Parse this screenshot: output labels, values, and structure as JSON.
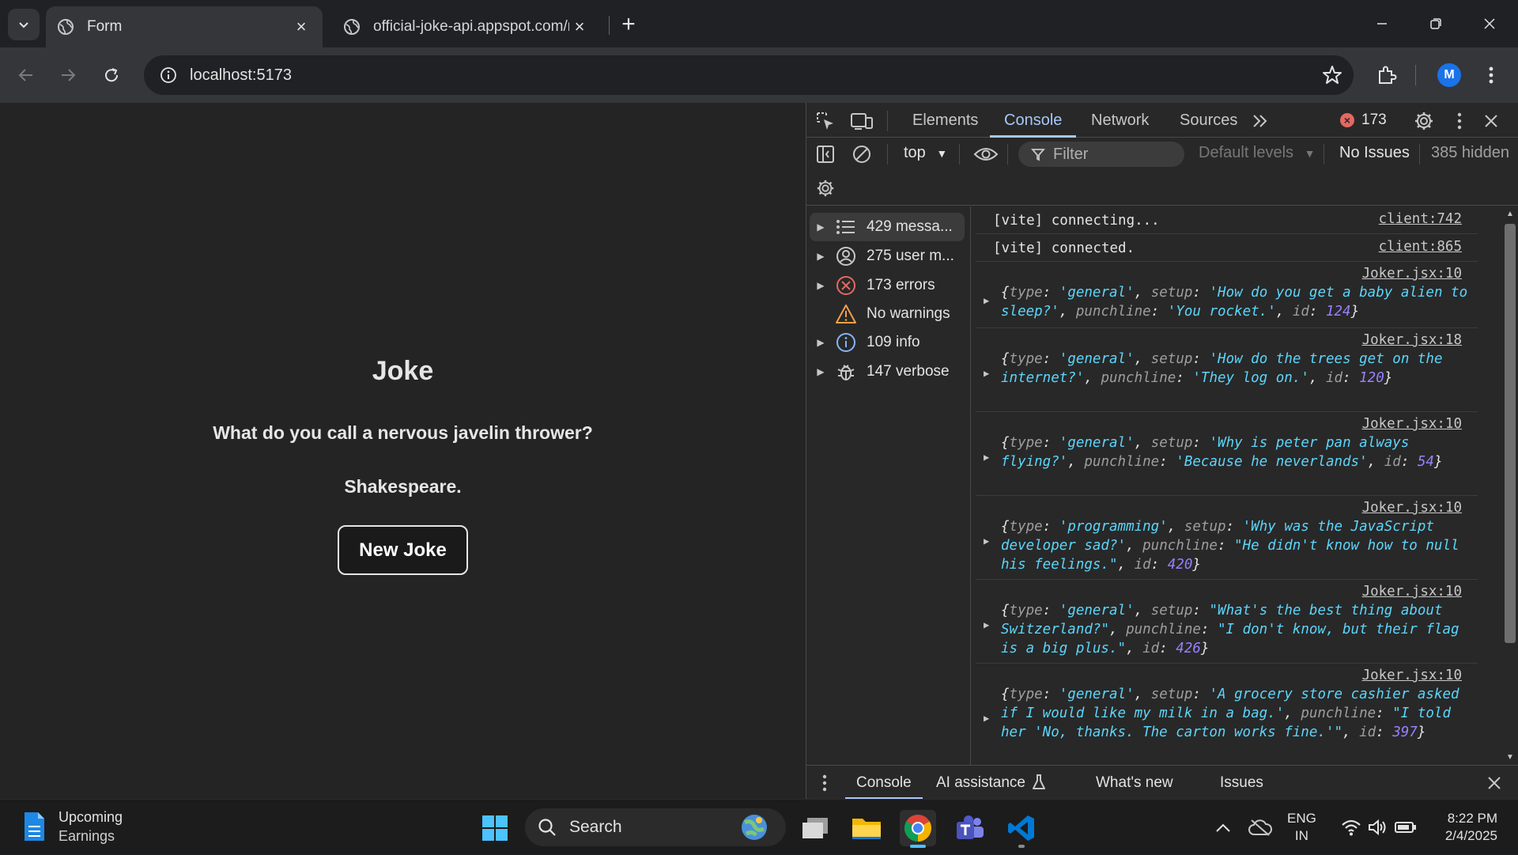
{
  "browser": {
    "tabs": [
      {
        "title": "Form",
        "active": true
      },
      {
        "title": "official-joke-api.appspot.com/r",
        "active": false
      }
    ],
    "url": "localhost:5173",
    "profile_initial": "M"
  },
  "page": {
    "heading": "Joke",
    "setup": "What do you call a nervous javelin thrower?",
    "punchline": "Shakespeare.",
    "button_label": "New Joke"
  },
  "devtools": {
    "tabs": [
      "Elements",
      "Console",
      "Network",
      "Sources"
    ],
    "active_tab": "Console",
    "error_badge": "173",
    "context": "top",
    "filter_placeholder": "Filter",
    "levels": "Default levels",
    "issues": "No Issues",
    "hidden": "385 hidden",
    "sidebar": [
      {
        "label": "429 messa...",
        "icon": "list-icon"
      },
      {
        "label": "275 user m...",
        "icon": "user-icon"
      },
      {
        "label": "173 errors",
        "icon": "error-icon"
      },
      {
        "label": "No warnings",
        "icon": "warning-icon"
      },
      {
        "label": "109 info",
        "icon": "info-icon"
      },
      {
        "label": "147 verbose",
        "icon": "bug-icon"
      }
    ],
    "logs": [
      {
        "text": "[vite] connecting...",
        "source": "client:742"
      },
      {
        "text": "[vite] connected.",
        "source": "client:865"
      },
      {
        "source": "Joker.jsx:10",
        "type": "general",
        "setup": "How do you get a baby alien to sleep?",
        "punchline": "You rocket.",
        "id": "124"
      },
      {
        "source": "Joker.jsx:18",
        "type": "general",
        "setup": "How do the trees get on the internet?",
        "punchline": "They log on.",
        "id": "120"
      },
      {
        "source": "Joker.jsx:10",
        "type": "general",
        "setup": "Why is peter pan always flying?",
        "punchline": "Because he neverlands",
        "id": "54"
      },
      {
        "source": "Joker.jsx:10",
        "type": "programming",
        "setup": "Why was the JavaScript developer sad?",
        "punchline": "He didn't know how to null his feelings.",
        "id": "420"
      },
      {
        "source": "Joker.jsx:10",
        "type": "general",
        "setup": "What's the best thing about Switzerland?",
        "punchline": "I don't know, but their flag is a big plus.",
        "id": "426"
      },
      {
        "source": "Joker.jsx:10",
        "type": "general",
        "setup": "A grocery store cashier asked if I would like my milk in a bag.",
        "punchline": "I told her 'No, thanks. The carton works fine.'",
        "id": "397"
      }
    ],
    "drawer_tabs": [
      "Console",
      "AI assistance",
      "What's new",
      "Issues"
    ]
  },
  "taskbar": {
    "widget_title": "Upcoming",
    "widget_sub": "Earnings",
    "search": "Search",
    "lang_1": "ENG",
    "lang_2": "IN",
    "time": "8:22 PM",
    "date": "2/4/2025"
  }
}
